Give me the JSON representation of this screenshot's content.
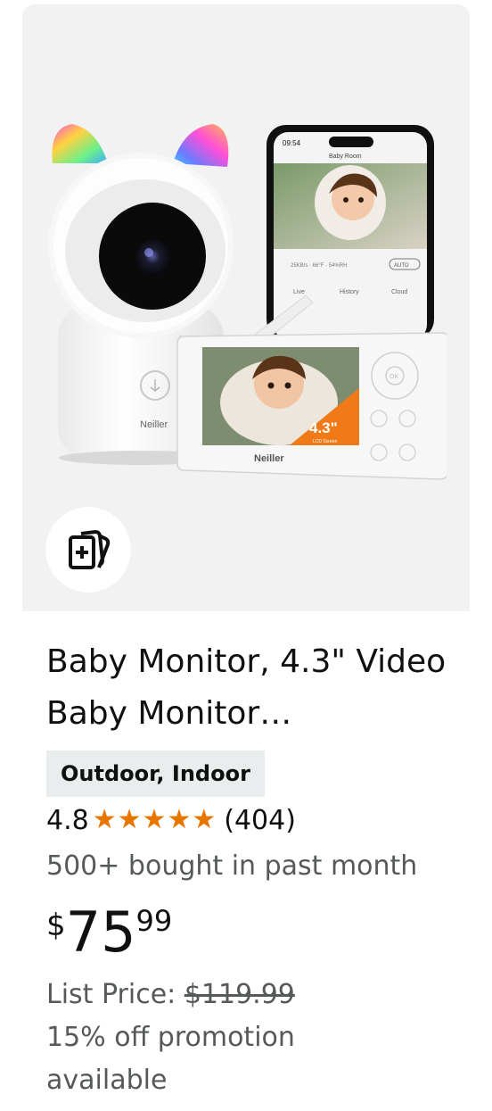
{
  "product": {
    "title": "Baby Monitor, 4.3\" Video Baby Monitor…",
    "badge": "Outdoor, Indoor",
    "rating": "4.8",
    "stars_shown": 5,
    "review_count": "(404)",
    "bought": "500+ bought in past month",
    "price": {
      "symbol": "$",
      "whole": "75",
      "fraction": "99"
    },
    "list_price_label": "List Price: ",
    "list_price_value": "$119.99",
    "promotion": "15% off promotion available"
  },
  "image": {
    "brand_on_camera": "Neiller",
    "brand_on_monitor": "Neiller",
    "phone_time": "09:54",
    "phone_title": "Baby Room",
    "phone_tabs": [
      "Live",
      "History",
      "Cloud"
    ],
    "phone_auto": "AUTO",
    "screen_size_label": "4.3\"",
    "screen_size_sub": "LCD Screen",
    "ok_label": "OK"
  },
  "colors": {
    "star": "#e77600",
    "badge_bg": "#eaeded",
    "image_bg": "#f2f2f2",
    "secondary_text": "#565959"
  },
  "icons": {
    "compare": "compare-cards-icon",
    "star": "star-icon"
  }
}
